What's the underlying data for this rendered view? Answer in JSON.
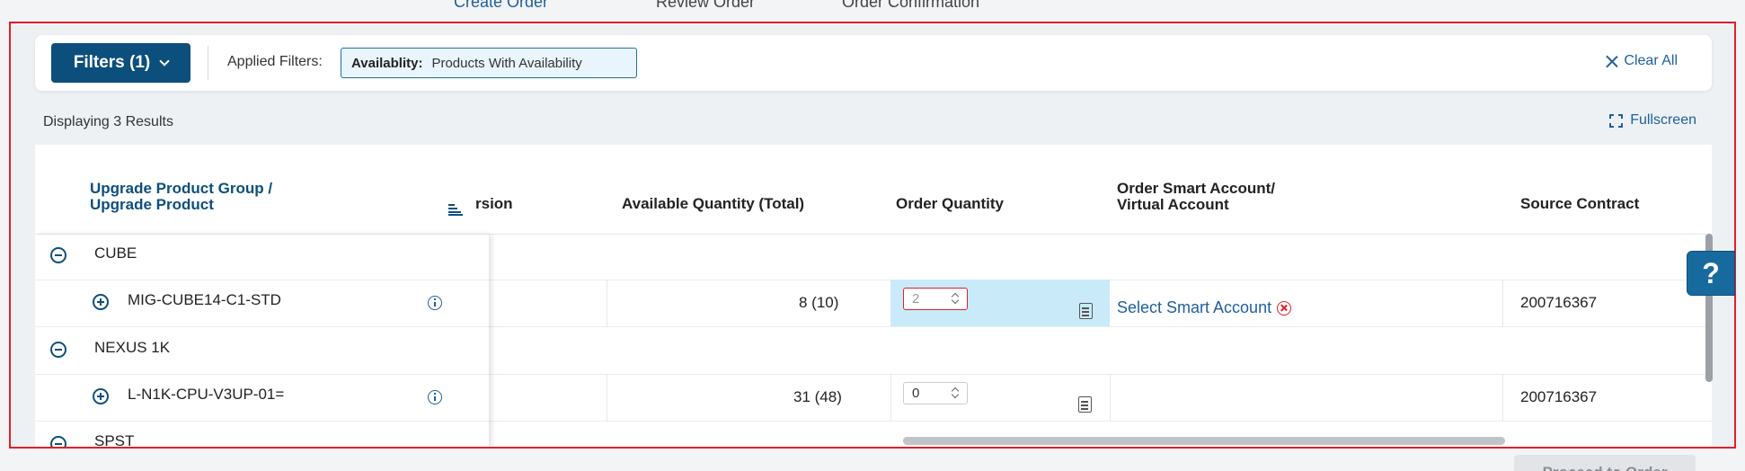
{
  "steps": [
    "Create Order",
    "Review Order",
    "Order Confirmation"
  ],
  "filters": {
    "button_label": "Filters (1)",
    "applied_label": "Applied Filters:",
    "chip_key": "Availablity:",
    "chip_value": "Products With Availability",
    "clear_all": "Clear All"
  },
  "results_text": "Displaying 3 Results",
  "fullscreen_label": "Fullscreen",
  "table": {
    "headers": {
      "product_group_line1": "Upgrade Product Group /",
      "product_group_line2": "Upgrade Product",
      "version_partial": "rsion",
      "available_quantity": "Available Quantity (Total)",
      "order_quantity": "Order Quantity",
      "smart_account_line1": "Order Smart Account/",
      "smart_account_line2": "Virtual Account",
      "source_contract": "Source Contract"
    },
    "groups": [
      {
        "name": "CUBE",
        "items": [
          {
            "product": "MIG-CUBE14-C1-STD",
            "available": "8 (10)",
            "order_qty": "2",
            "smart_account": "Select Smart Account",
            "source_contract": "200716367"
          }
        ]
      },
      {
        "name": "NEXUS 1K",
        "items": [
          {
            "product": "L-N1K-CPU-V3UP-01=",
            "available": "31 (48)",
            "order_qty": "0",
            "smart_account": "",
            "source_contract": "200716367"
          }
        ]
      },
      {
        "name": "SPST",
        "items": []
      }
    ]
  },
  "help_label": "?",
  "proceed_label": "Proceed to Order",
  "colors": {
    "primary": "#0d4f7c",
    "link": "#1f5f9a",
    "error": "#e0202a",
    "active_cell": "#c9ebf9"
  }
}
